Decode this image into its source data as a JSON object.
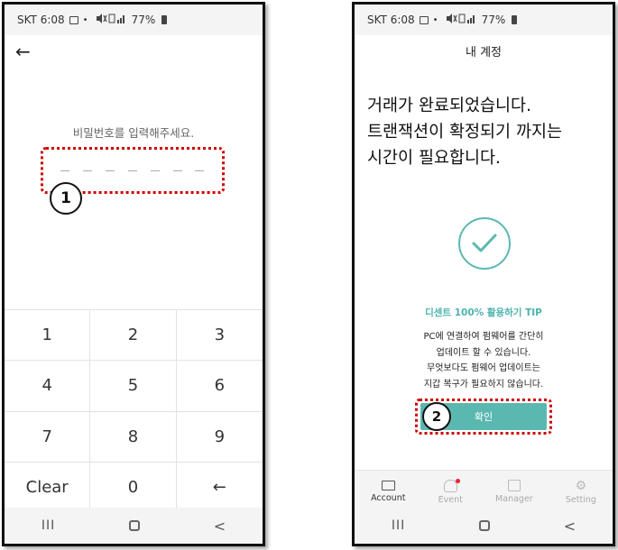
{
  "status": {
    "carrier_time": "SKT 6:08",
    "dot": "•",
    "battery_pct": "77%"
  },
  "left": {
    "password_prompt": "비밀번호를 입력해주세요.",
    "pin_slots": 7,
    "callout": "1",
    "keys": [
      "1",
      "2",
      "3",
      "4",
      "5",
      "6",
      "7",
      "8",
      "9",
      "Clear",
      "0",
      "←"
    ],
    "back_glyph": "←"
  },
  "right": {
    "title": "내 계정",
    "headline": [
      "거래가 완료되었습니다.",
      "트랜잭션이 확정되기 까지는",
      "시간이 필요합니다."
    ],
    "tip_title": "디센트 100% 활용하기 TIP",
    "tip_lines": [
      "PC에 연결하여 펌웨어를 간단히",
      "업데이트 할 수 있습니다.",
      "무엇보다도 펌웨어 업데이트는",
      "지갑 복구가 필요하지 않습니다."
    ],
    "confirm_label": "확인",
    "callout": "2",
    "tabs": [
      {
        "label": "Account",
        "icon": "wallet-icon",
        "active": true
      },
      {
        "label": "Event",
        "icon": "gift-icon",
        "active": false
      },
      {
        "label": "Manager",
        "icon": "manager-icon",
        "active": false
      },
      {
        "label": "Setting",
        "icon": "gear-icon",
        "active": false
      }
    ]
  },
  "nav": {
    "recent": "III",
    "back": "<"
  },
  "colors": {
    "accent": "#5bb8b1",
    "highlight": "#cc0000"
  }
}
